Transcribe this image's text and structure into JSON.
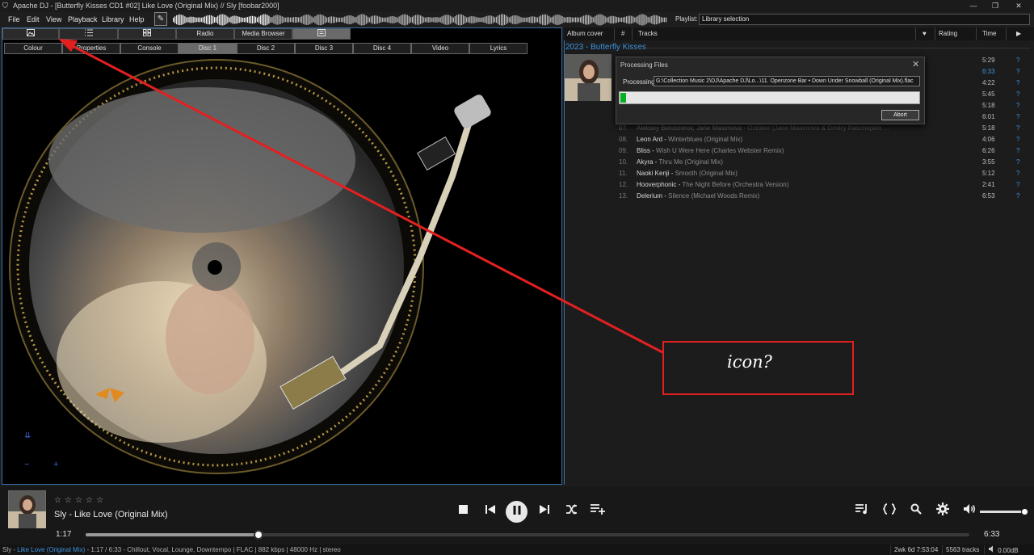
{
  "window": {
    "title": "Apache DJ - [Butterfly Kisses CD1 #02] Like Love (Original Mix) // Sly  [foobar2000]",
    "controls": [
      "—",
      "❐",
      "✕"
    ]
  },
  "menu": [
    "File",
    "Edit",
    "View",
    "Playback",
    "Library",
    "Help"
  ],
  "playlist": {
    "label": "Playlist:",
    "value": "Library selection"
  },
  "left_panel": {
    "top_tabs": [
      "",
      "",
      "",
      "Radio",
      "Media Browser",
      ""
    ],
    "sub_tabs": [
      "Colour",
      "Properties",
      "Console",
      "Disc 1",
      "Disc 2",
      "Disc 3",
      "Disc 4",
      "Video",
      "Lyrics"
    ],
    "selected_sub_tab": "Disc 1",
    "corner_symbols": [
      "⇊",
      "−",
      "+"
    ]
  },
  "right_panel": {
    "columns": [
      "Album cover",
      "#",
      "Tracks",
      "♥",
      "Rating",
      "Time",
      "▶"
    ],
    "album_header": "2023 - Butterfly Kisses",
    "visible_times_top": [
      "5:29",
      "6:33",
      "4:22",
      "5:45",
      "5:18",
      "6:01"
    ],
    "tracks": [
      {
        "num": "07.",
        "artist": "Aleksey Beloozerov, Jane Maximova",
        "title": "October (Jane Maximova & Dmitry Raschepkin ...",
        "time": "5:18",
        "rating": "?"
      },
      {
        "num": "08.",
        "artist": "Leon Ard",
        "title": "Winterblues (Original Mix)",
        "time": "4:06",
        "rating": "?"
      },
      {
        "num": "09.",
        "artist": "Bliss",
        "title": "Wish U Were Here (Charles Webster Remix)",
        "time": "6:26",
        "rating": "?"
      },
      {
        "num": "10.",
        "artist": "Akyra",
        "title": "Thru Me (Original Mix)",
        "time": "3:55",
        "rating": "?"
      },
      {
        "num": "11.",
        "artist": "Naoki Kenji",
        "title": "Smooth (Original Mix)",
        "time": "5:12",
        "rating": "?"
      },
      {
        "num": "12.",
        "artist": "Hooverphonic",
        "title": "The Night Before (Orchestra Version)",
        "time": "2:41",
        "rating": "?"
      },
      {
        "num": "13.",
        "artist": "Delerium",
        "title": "Silence (Michael Woods Remix)",
        "time": "6:53",
        "rating": "?"
      }
    ]
  },
  "dialog": {
    "title": "Processing Files",
    "processing_label": "Processing:",
    "path": "G:\\Collection Music 2\\DJ\\Apache DJ\\Lo...\\11. Openzone Bar • Down Under Snowball (Original Mix).flac",
    "progress": 0.02,
    "abort_label": "Abort"
  },
  "player": {
    "stars": [
      "☆",
      "☆",
      "☆",
      "☆",
      "☆"
    ],
    "now_playing": "Sly - Like Love (Original Mix)",
    "time_current": "1:17",
    "time_total": "6:33",
    "progress": 0.196,
    "volume": 0.95
  },
  "status": {
    "artist": "Sly - ",
    "title": "Like Love (Original Mix)",
    "details": " - 1:17 / 6:33 - Chillout, Vocal, Lounge, Downtempo | FLAC | 882 kbps | 48000 Hz | stereo",
    "uptime": "2wk 6d 7:53:04",
    "tracks": "5563 tracks",
    "volume": "0.00dB"
  },
  "annotation": {
    "text": "icon?",
    "color": "#e32020"
  }
}
